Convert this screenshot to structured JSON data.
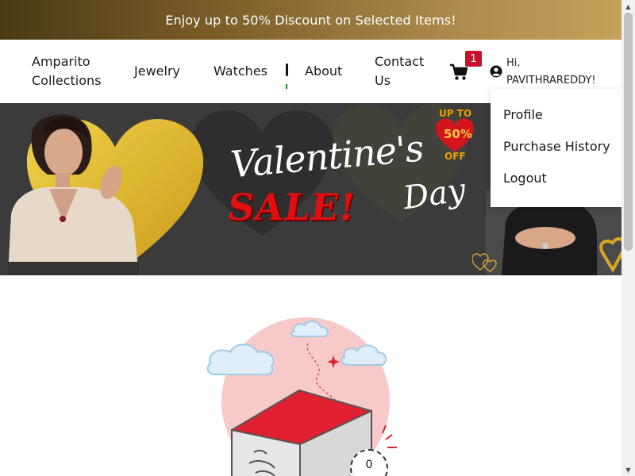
{
  "promo": {
    "text": "Enjoy up to 50% Discount on Selected Items!"
  },
  "nav": {
    "brand": [
      "Amparito",
      "Collections"
    ],
    "jewelry": "Jewelry",
    "watches": "Watches",
    "about": "About",
    "contact": [
      "Contact",
      "Us"
    ],
    "cart_count": "1",
    "greeting": [
      "Hi,",
      "PAVITHRAREDDY!"
    ]
  },
  "dropdown": {
    "items": [
      "Profile",
      "Purchase History",
      "Logout"
    ]
  },
  "hero": {
    "title": "Valentine's",
    "day": "Day",
    "sale": "SALE!",
    "up_to": "UP TO",
    "percent": "50%",
    "off": "OFF"
  },
  "empty_state": {
    "counter": "0"
  },
  "colors": {
    "accent": "#c8102e",
    "gold": "#c4a25a",
    "hero_bg": "#3b3b3b"
  },
  "icons": {
    "cart": "cart-icon",
    "user": "user-circle-icon"
  }
}
